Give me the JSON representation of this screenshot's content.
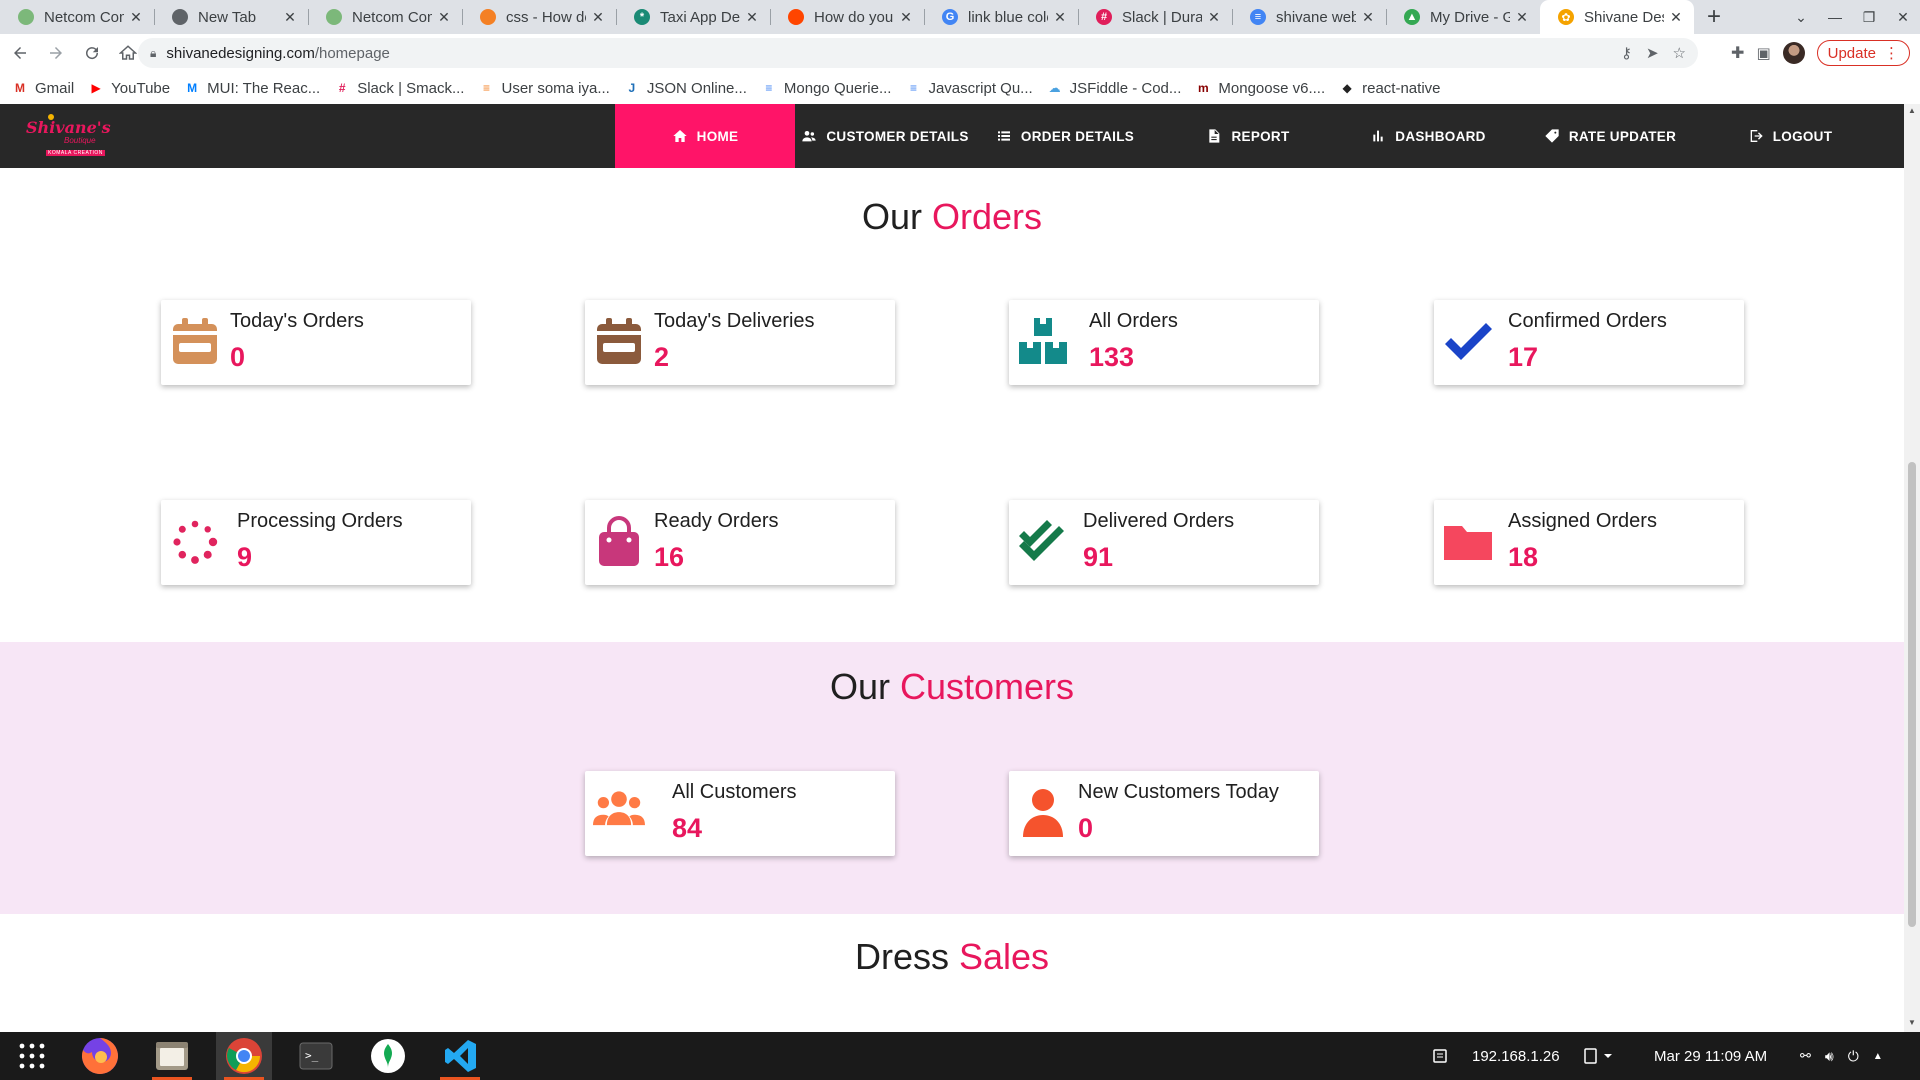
{
  "browser": {
    "tabs": [
      {
        "title": "Netcom Com",
        "favicon_color": "#7cb87a",
        "favicon_glyph": ""
      },
      {
        "title": "New Tab",
        "favicon_color": "#5f6368",
        "favicon_glyph": ""
      },
      {
        "title": "Netcom Com",
        "favicon_color": "#7cb87a",
        "favicon_glyph": ""
      },
      {
        "title": "css - How do",
        "favicon_color": "#f48024",
        "favicon_glyph": ""
      },
      {
        "title": "Taxi App Dev",
        "favicon_color": "#1a8a75",
        "favicon_glyph": "*"
      },
      {
        "title": "How do you r",
        "favicon_color": "#ff4500",
        "favicon_glyph": ""
      },
      {
        "title": "link blue colo",
        "favicon_color": "#4285f4",
        "favicon_glyph": "G"
      },
      {
        "title": "Slack | Durai",
        "favicon_color": "#e01e5a",
        "favicon_glyph": "#"
      },
      {
        "title": "shivane web",
        "favicon_color": "#4285f4",
        "favicon_glyph": "≡"
      },
      {
        "title": "My Drive - Go",
        "favicon_color": "#34a853",
        "favicon_glyph": "▲"
      },
      {
        "title": "Shivane Desi",
        "favicon_color": "#f5a300",
        "favicon_glyph": "✿"
      }
    ],
    "new_tab_label": "+",
    "url_host": "shivanedesigning.com",
    "url_path": "/homepage",
    "update_label": "Update",
    "bookmarks": [
      {
        "label": "Gmail",
        "icon_color": "#d93025",
        "glyph": "M"
      },
      {
        "label": "YouTube",
        "icon_color": "#ff0000",
        "glyph": "▶"
      },
      {
        "label": "MUI: The Reac...",
        "icon_color": "#007fff",
        "glyph": "M"
      },
      {
        "label": "Slack | Smack...",
        "icon_color": "#e01e5a",
        "glyph": "#"
      },
      {
        "label": "User soma iya...",
        "icon_color": "#f48024",
        "glyph": "≡"
      },
      {
        "label": "JSON Online...",
        "icon_color": "#1e6fb8",
        "glyph": "J"
      },
      {
        "label": "Mongo Querie...",
        "icon_color": "#4285f4",
        "glyph": "≡"
      },
      {
        "label": "Javascript Qu...",
        "icon_color": "#4285f4",
        "glyph": "≡"
      },
      {
        "label": "JSFiddle - Cod...",
        "icon_color": "#4aa1e0",
        "glyph": "☁"
      },
      {
        "label": "Mongoose v6....",
        "icon_color": "#880000",
        "glyph": "m"
      },
      {
        "label": "react-native",
        "icon_color": "#222222",
        "glyph": "◆"
      }
    ]
  },
  "site": {
    "logo_text": "Shivane's",
    "logo_sub": "Boutique",
    "logo_tag": "KOMALA CREATION",
    "menu": [
      {
        "label": "HOME",
        "icon": "home-icon",
        "active": true
      },
      {
        "label": "CUSTOMER DETAILS",
        "icon": "people-icon",
        "active": false
      },
      {
        "label": "ORDER DETAILS",
        "icon": "list-icon",
        "active": false
      },
      {
        "label": "REPORT",
        "icon": "document-icon",
        "active": false
      },
      {
        "label": "DASHBOARD",
        "icon": "bar-chart-icon",
        "active": false
      },
      {
        "label": "RATE UPDATER",
        "icon": "tag-icon",
        "active": false
      },
      {
        "label": "LOGOUT",
        "icon": "logout-icon",
        "active": false
      }
    ],
    "accent_color": "#e8175d",
    "orders_title": {
      "prefix": "Our",
      "accent": "Orders"
    },
    "order_cards": [
      {
        "label": "Today's Orders",
        "value": "0",
        "icon": "calendar-icon",
        "icon_color": "#d4915a"
      },
      {
        "label": "Today's Deliveries",
        "value": "2",
        "icon": "calendar-icon",
        "icon_color": "#8b5a3c"
      },
      {
        "label": "All Orders",
        "value": "133",
        "icon": "boxes-icon",
        "icon_color": "#138a8a"
      },
      {
        "label": "Confirmed Orders",
        "value": "17",
        "icon": "check-icon",
        "icon_color": "#1a44c8"
      },
      {
        "label": "Processing Orders",
        "value": "9",
        "icon": "spinner-icon",
        "icon_color": "#e0245e"
      },
      {
        "label": "Ready Orders",
        "value": "16",
        "icon": "shopping-bag-icon",
        "icon_color": "#c8377b"
      },
      {
        "label": "Delivered Orders",
        "value": "91",
        "icon": "double-check-icon",
        "icon_color": "#157a4a"
      },
      {
        "label": "Assigned Orders",
        "value": "18",
        "icon": "folder-icon",
        "icon_color": "#f5475e"
      }
    ],
    "customers_title": {
      "prefix": "Our",
      "accent": "Customers"
    },
    "customer_cards": [
      {
        "label": "All Customers",
        "value": "84",
        "icon": "group-icon",
        "icon_color": "#ff7a45"
      },
      {
        "label": "New Customers Today",
        "value": "0",
        "icon": "person-icon",
        "icon_color": "#f5532d"
      }
    ],
    "sales_title": {
      "prefix": "Dress",
      "accent": "Sales"
    }
  },
  "taskbar": {
    "apps": [
      "app-grid-icon",
      "firefox-icon",
      "files-icon",
      "chrome-icon",
      "terminal-icon",
      "mongodb-compass-icon",
      "vscode-icon"
    ],
    "ip": "192.168.1.26",
    "datetime": "Mar 29  11:09 AM"
  }
}
